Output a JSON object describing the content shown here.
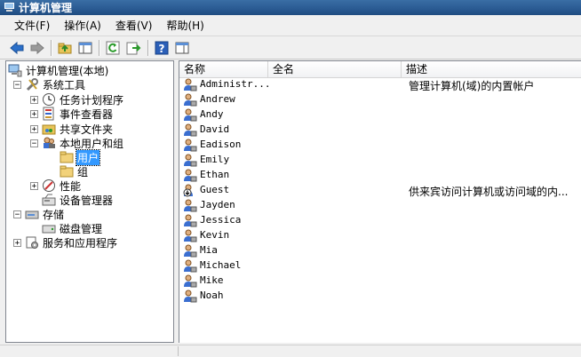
{
  "window": {
    "title": "计算机管理"
  },
  "menu": [
    {
      "label": "文件(F)"
    },
    {
      "label": "操作(A)"
    },
    {
      "label": "查看(V)"
    },
    {
      "label": "帮助(H)"
    }
  ],
  "toolbar": {
    "buttons": [
      "back-arrow-icon",
      "forward-arrow-icon",
      "up-folder-icon",
      "show-tree-icon",
      "refresh-icon",
      "export-list-icon",
      "help-icon",
      "action-pane-icon"
    ]
  },
  "tree": {
    "root": "计算机管理(本地)",
    "system_tools": "系统工具",
    "task_scheduler": "任务计划程序",
    "event_viewer": "事件查看器",
    "shared_folders": "共享文件夹",
    "local_users_groups": "本地用户和组",
    "users": "用户",
    "groups": "组",
    "performance": "性能",
    "device_manager": "设备管理器",
    "storage": "存储",
    "disk_management": "磁盘管理",
    "services_apps": "服务和应用程序"
  },
  "list": {
    "columns": {
      "name": "名称",
      "fullname": "全名",
      "description": "描述"
    },
    "rows": [
      {
        "name": "Administr...",
        "fullname": "",
        "description": "管理计算机(域)的内置帐户",
        "disabled": false
      },
      {
        "name": "Andrew",
        "fullname": "",
        "description": "",
        "disabled": false
      },
      {
        "name": "Andy",
        "fullname": "",
        "description": "",
        "disabled": false
      },
      {
        "name": "David",
        "fullname": "",
        "description": "",
        "disabled": false
      },
      {
        "name": "Eadison",
        "fullname": "",
        "description": "",
        "disabled": false
      },
      {
        "name": "Emily",
        "fullname": "",
        "description": "",
        "disabled": false
      },
      {
        "name": "Ethan",
        "fullname": "",
        "description": "",
        "disabled": false
      },
      {
        "name": "Guest",
        "fullname": "",
        "description": "供来宾访问计算机或访问域的内...",
        "disabled": true
      },
      {
        "name": "Jayden",
        "fullname": "",
        "description": "",
        "disabled": false
      },
      {
        "name": "Jessica",
        "fullname": "",
        "description": "",
        "disabled": false
      },
      {
        "name": "Kevin",
        "fullname": "",
        "description": "",
        "disabled": false
      },
      {
        "name": "Mia",
        "fullname": "",
        "description": "",
        "disabled": false
      },
      {
        "name": "Michael",
        "fullname": "",
        "description": "",
        "disabled": false
      },
      {
        "name": "Mike",
        "fullname": "",
        "description": "",
        "disabled": false
      },
      {
        "name": "Noah",
        "fullname": "",
        "description": "",
        "disabled": false
      }
    ]
  },
  "colors": {
    "selection": "#3399ff",
    "title_bar": "#2a5a92"
  }
}
